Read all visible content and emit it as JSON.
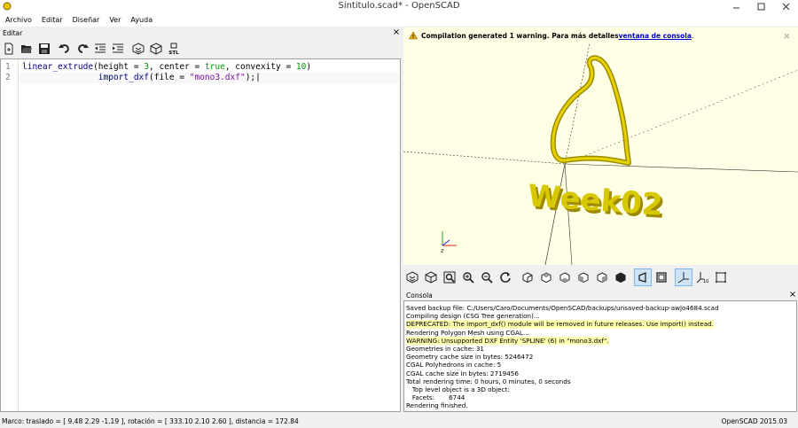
{
  "window": {
    "title": "Sintitulo.scad* - OpenSCAD"
  },
  "menu": [
    "Archivo",
    "Editar",
    "Diseñar",
    "Ver",
    "Ayuda"
  ],
  "editor_panel": {
    "title": "Editar",
    "close": "×"
  },
  "editor": {
    "lines": [
      {
        "num": "1",
        "tokens": [
          {
            "t": "linear_extrude",
            "c": "kw"
          },
          {
            "t": "(height = ",
            "c": ""
          },
          {
            "t": "3",
            "c": "num"
          },
          {
            "t": ", center = ",
            "c": ""
          },
          {
            "t": "true",
            "c": "num"
          },
          {
            "t": ", convexity = ",
            "c": ""
          },
          {
            "t": "10",
            "c": "num"
          },
          {
            "t": ")",
            "c": ""
          }
        ]
      },
      {
        "num": "2",
        "tokens": [
          {
            "t": "               import_dxf",
            "c": "kw"
          },
          {
            "t": "(file = ",
            "c": ""
          },
          {
            "t": "\"mono3.dxf\"",
            "c": "str"
          },
          {
            "t": ");",
            "c": ""
          }
        ]
      }
    ]
  },
  "notification": {
    "message": "Compilation generated 1 warning. Para más detalles ",
    "link": "ventana de consola",
    "suffix": ".",
    "close": "×"
  },
  "viewport": {
    "model_text": "Week02",
    "axis_label_z": "z"
  },
  "console_panel": {
    "title": "Consola",
    "close": "×"
  },
  "console": [
    {
      "text": "Saved backup file: C:/Users/Caro/Documents/OpenSCAD/backups/unsaved-backup-awjo4684.scad",
      "warn": false
    },
    {
      "text": "Compiling design (CSG Tree generation)...",
      "warn": false
    },
    {
      "text": "DEPRECATED: The import_dxf() module will be removed in future releases. Use import() instead.",
      "warn": true
    },
    {
      "text": "Rendering Polygon Mesh using CGAL...",
      "warn": false
    },
    {
      "text": "WARNING: Unsupported DXF Entity 'SPLINE' (6) in \"mono3.dxf\".",
      "warn": true
    },
    {
      "text": "Geometries in cache: 31",
      "warn": false
    },
    {
      "text": "Geometry cache size in bytes: 5246472",
      "warn": false
    },
    {
      "text": "CGAL Polyhedrons in cache: 5",
      "warn": false
    },
    {
      "text": "CGAL cache size in bytes: 2719456",
      "warn": false
    },
    {
      "text": "Total rendering time: 0 hours, 0 minutes, 0 seconds",
      "warn": false
    },
    {
      "text": "   Top level object is a 3D object:",
      "warn": false
    },
    {
      "text": "   Facets:       6744",
      "warn": false
    },
    {
      "text": "Rendering finished.",
      "warn": false
    }
  ],
  "status": {
    "left": "Marco: traslado = [ 9.48 2.29 -1.19 ], rotación = [ 333.10 2.10 2.60 ], distancia = 172.84",
    "right": "OpenSCAD 2015.03"
  },
  "colors": {
    "model": "#d8c800",
    "model_dark": "#9c8a00",
    "viewport_bg": "#ffffe5",
    "warn_bg": "#ffffb0"
  }
}
